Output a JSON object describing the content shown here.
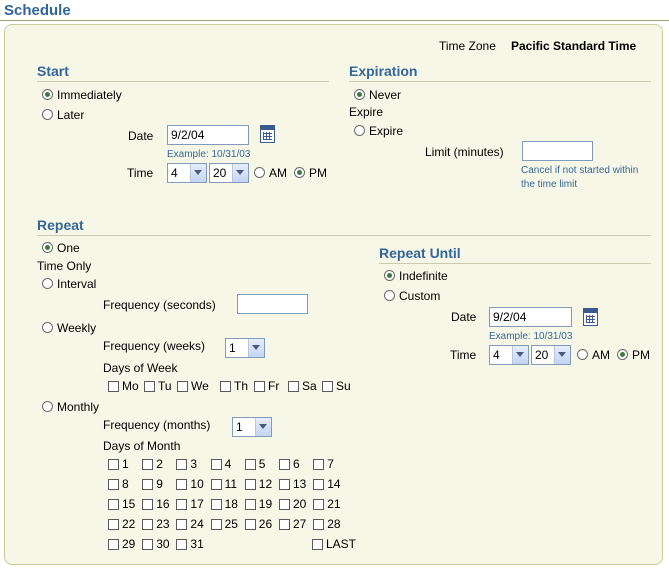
{
  "page": {
    "title": "Schedule"
  },
  "timezone": {
    "label": "Time Zone",
    "value": "Pacific Standard Time"
  },
  "start": {
    "header": "Start",
    "immediately": "Immediately",
    "later": "Later",
    "date_label": "Date",
    "date_value": "9/2/04",
    "date_example": "Example: 10/31/03",
    "time_label": "Time",
    "hour": "4",
    "minute": "20",
    "am": "AM",
    "pm": "PM"
  },
  "expiration": {
    "header": "Expiration",
    "never_line1": "Never",
    "never_line2": "Expire",
    "expire": "Expire",
    "limit_label": "Limit (minutes)",
    "limit_value": "",
    "cancel_note_line1": "Cancel if not started within",
    "cancel_note_line2": "the time limit"
  },
  "repeat": {
    "header": "Repeat",
    "one_line1": "One",
    "one_line2": "Time Only",
    "interval": "Interval",
    "freq_seconds_label": "Frequency (seconds)",
    "freq_seconds_value": "",
    "weekly": "Weekly",
    "freq_weeks_label": "Frequency (weeks)",
    "freq_weeks_value": "1",
    "days_of_week_label": "Days of Week",
    "days_of_week": [
      "Mo",
      "Tu",
      "We",
      "Th",
      "Fr",
      "Sa",
      "Su"
    ],
    "monthly": "Monthly",
    "freq_months_label": "Frequency (months)",
    "freq_months_value": "1",
    "days_of_month_label": "Days of Month",
    "days_of_month": [
      "1",
      "2",
      "3",
      "4",
      "5",
      "6",
      "7",
      "8",
      "9",
      "10",
      "11",
      "12",
      "13",
      "14",
      "15",
      "16",
      "17",
      "18",
      "19",
      "20",
      "21",
      "22",
      "23",
      "24",
      "25",
      "26",
      "27",
      "28",
      "29",
      "30",
      "31"
    ],
    "last": "LAST"
  },
  "repeat_until": {
    "header": "Repeat Until",
    "indefinite": "Indefinite",
    "custom": "Custom",
    "date_label": "Date",
    "date_value": "9/2/04",
    "date_example": "Example: 10/31/03",
    "time_label": "Time",
    "hour": "4",
    "minute": "20",
    "am": "AM",
    "pm": "PM"
  },
  "colors": {
    "header": "#336699",
    "panel_bg": "#f7f7e7",
    "panel_border": "#c9cc99"
  }
}
